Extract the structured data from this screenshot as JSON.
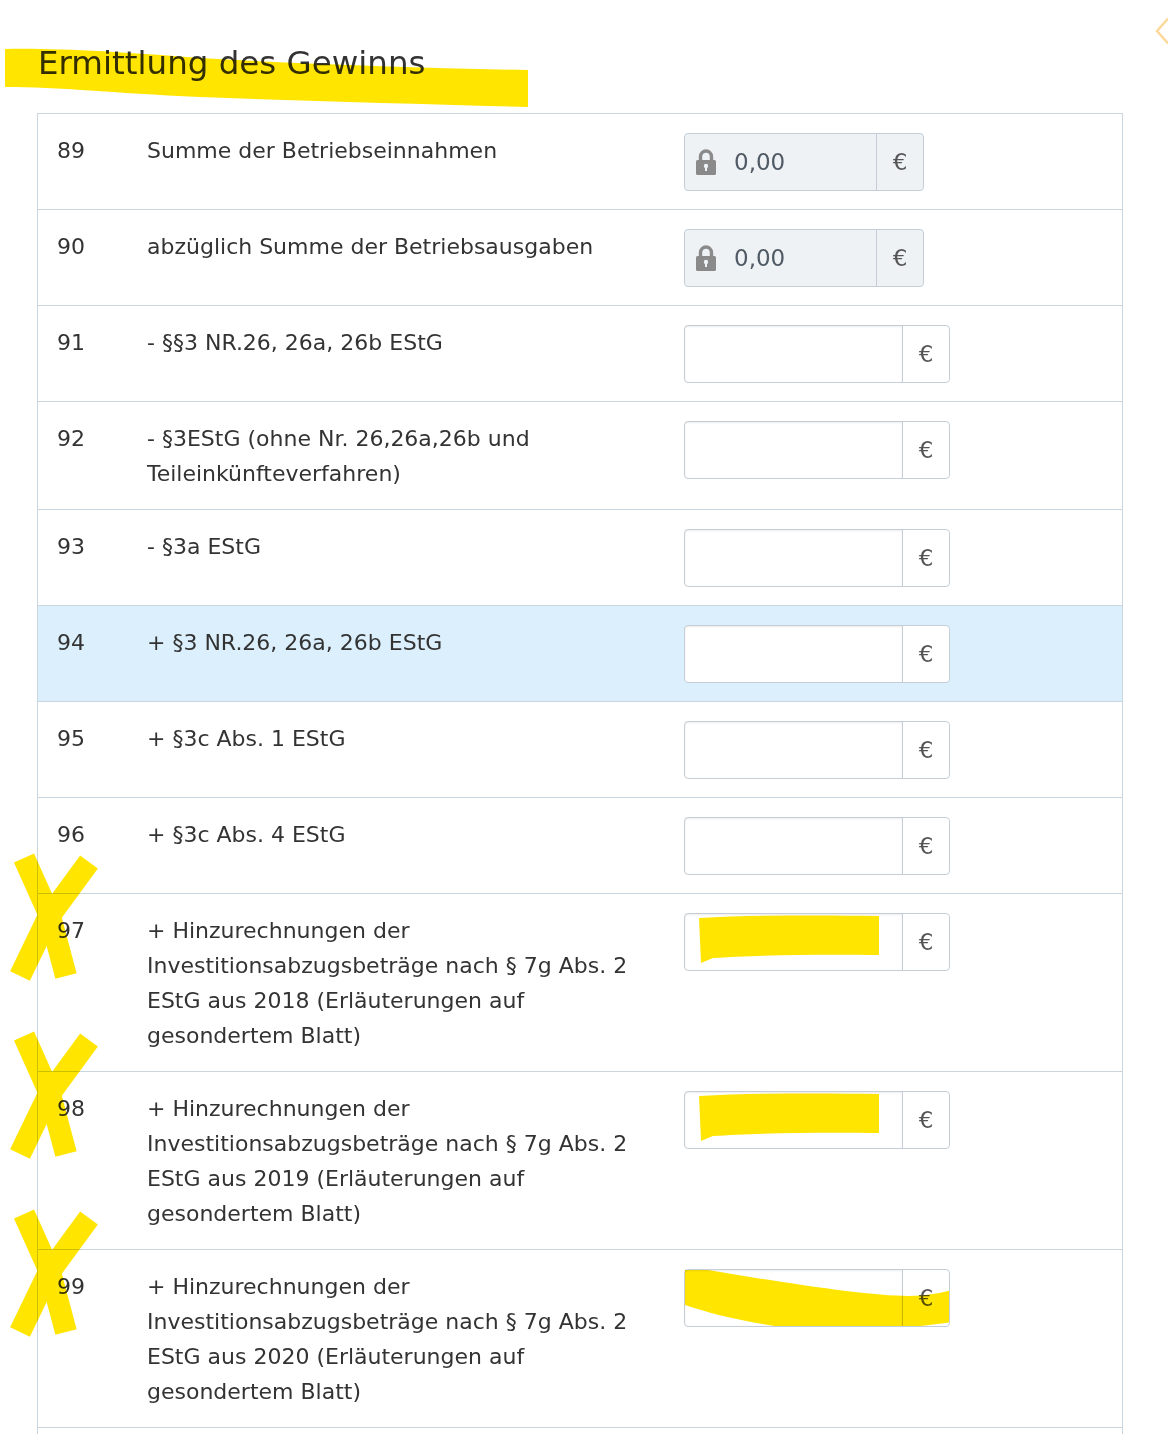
{
  "section": {
    "title": "Ermittlung des Gewinns",
    "marker_highlight": true
  },
  "rows": [
    {
      "number": "89",
      "label": "Summe der Betriebseinnahmen",
      "highlighted": false,
      "crossed": false,
      "field": {
        "locked": true,
        "value": "0,00",
        "unit": "€"
      }
    },
    {
      "number": "90",
      "label": "abzüglich Summe der Betriebsausgaben",
      "highlighted": false,
      "crossed": false,
      "field": {
        "locked": true,
        "value": "0,00",
        "unit": "€"
      }
    },
    {
      "number": "91",
      "label": "- §§3 NR.26, 26a, 26b EStG",
      "highlighted": false,
      "crossed": false,
      "field": {
        "locked": false,
        "unit": "€"
      }
    },
    {
      "number": "92",
      "label": "- §3EStG (ohne Nr. 26,26a,26b und Teileinkünfteverfahren)",
      "highlighted": false,
      "crossed": false,
      "field": {
        "locked": false,
        "unit": "€"
      }
    },
    {
      "number": "93",
      "label": "- §3a EStG",
      "highlighted": false,
      "crossed": false,
      "field": {
        "locked": false,
        "unit": "€"
      }
    },
    {
      "number": "94",
      "label": "+ §3 NR.26, 26a, 26b EStG",
      "highlighted": true,
      "crossed": false,
      "field": {
        "locked": false,
        "unit": "€"
      }
    },
    {
      "number": "95",
      "label": "+ §3c Abs. 1 EStG",
      "highlighted": false,
      "crossed": false,
      "field": {
        "locked": false,
        "unit": "€"
      }
    },
    {
      "number": "96",
      "label": "+ §3c Abs. 4 EStG",
      "highlighted": false,
      "crossed": false,
      "field": {
        "locked": false,
        "unit": "€"
      }
    },
    {
      "number": "97",
      "label": "+ Hinzurechnungen der Investitionsabzugsbeträge nach § 7g Abs. 2 EStG aus 2018 (Erläuterungen auf gesondertem Blatt)",
      "highlighted": false,
      "crossed": true,
      "field": {
        "locked": false,
        "unit": "€",
        "marker": {
          "kind": "band"
        }
      }
    },
    {
      "number": "98",
      "label": "+ Hinzurechnungen der Investitionsabzugsbeträge nach § 7g Abs. 2 EStG aus 2019 (Erläuterungen auf gesondertem Blatt)",
      "highlighted": false,
      "crossed": true,
      "field": {
        "locked": false,
        "unit": "€",
        "marker": {
          "kind": "band"
        }
      }
    },
    {
      "number": "99",
      "label": "+ Hinzurechnungen der Investitionsabzugsbeträge nach § 7g Abs. 2 EStG aus 2020 (Erläuterungen auf gesondertem Blatt)",
      "highlighted": false,
      "crossed": true,
      "field": {
        "locked": false,
        "unit": "€",
        "marker": {
          "kind": "sweep"
        }
      }
    }
  ]
}
